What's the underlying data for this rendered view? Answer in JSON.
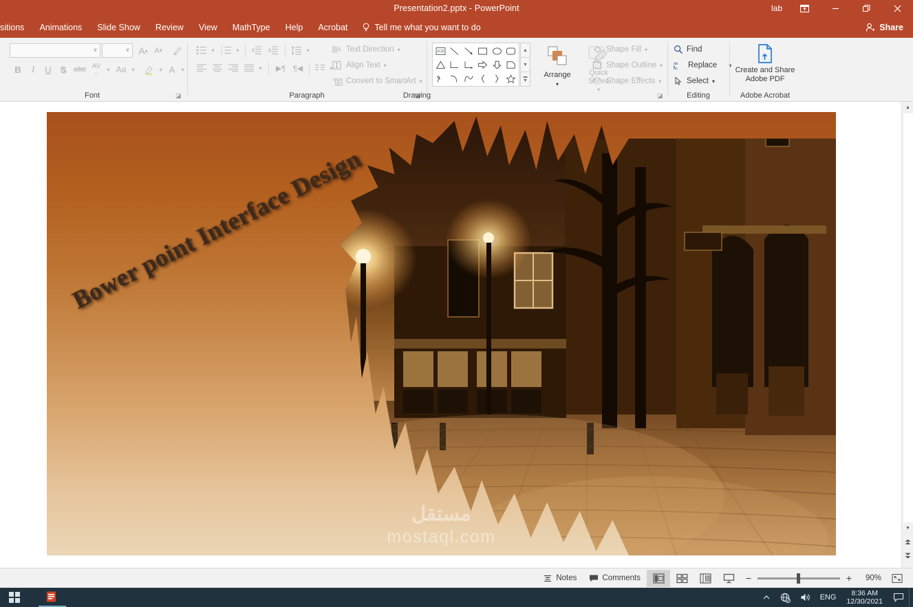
{
  "window": {
    "title": "Presentation2.pptx  -  PowerPoint",
    "user_label": "lab",
    "ribbon_display_options_icon": "ribbon-display-options-icon",
    "minimize_icon": "minimize-icon",
    "restore_icon": "restore-icon",
    "close_icon": "close-icon",
    "accent_color": "#b7472a"
  },
  "tabs": [
    {
      "label": "sitions"
    },
    {
      "label": "Animations"
    },
    {
      "label": "Slide Show"
    },
    {
      "label": "Review"
    },
    {
      "label": "View"
    },
    {
      "label": "MathType"
    },
    {
      "label": "Help"
    },
    {
      "label": "Acrobat"
    }
  ],
  "tellme": {
    "label": "Tell me what you want to do",
    "icon": "lightbulb-icon"
  },
  "share": {
    "label": "Share",
    "icon": "share-person-icon"
  },
  "ribbon": {
    "font_group": {
      "label": "Font",
      "font_name_value": "",
      "font_size_value": "",
      "grow_font": "A",
      "shrink_font": "A",
      "clear_formatting": "clear-formatting-icon",
      "bold": "B",
      "italic": "I",
      "underline": "U",
      "shadow": "S",
      "strikethrough": "abc",
      "character_spacing": "AV",
      "change_case": "Aa",
      "text_highlight": "text-highlight-icon",
      "font_color": "A"
    },
    "paragraph_group": {
      "label": "Paragraph",
      "bullets": "bullets-icon",
      "numbering": "numbering-icon",
      "decrease_indent": "decrease-indent-icon",
      "increase_indent": "increase-indent-icon",
      "line_spacing": "line-spacing-icon",
      "align_left": "align-left-icon",
      "align_center": "align-center-icon",
      "align_right": "align-right-icon",
      "justify": "justify-icon",
      "text_direction_rtl": "rtl-icon",
      "text_direction_ltr": "ltr-icon",
      "columns": "columns-icon",
      "text_direction_label": "Text Direction",
      "align_text_label": "Align Text",
      "convert_smartart_label": "Convert to SmartArt"
    },
    "drawing_group": {
      "label": "Drawing",
      "shapes": [
        "text-box-icon",
        "line-icon",
        "line-arrow-icon",
        "rectangle-icon",
        "oval-icon",
        "rounded-rectangle-icon",
        "triangle-icon",
        "elbow-connector-icon",
        "elbow-arrow-connector-icon",
        "right-arrow-icon",
        "down-arrow-icon",
        "flowchart-shape-icon",
        "scribble-icon",
        "curve-icon",
        "arc-icon",
        "left-brace-icon",
        "right-brace-icon",
        "star-icon"
      ],
      "gallery_up": "scroll-up-icon",
      "gallery_down": "scroll-down-icon",
      "gallery_more": "more-shapes-icon",
      "arrange_label": "Arrange",
      "quick_styles_label": "Quick Styles",
      "shape_fill_label": "Shape Fill",
      "shape_outline_label": "Shape Outline",
      "shape_effects_label": "Shape Effects"
    },
    "editing_group": {
      "label": "Editing",
      "find_label": "Find",
      "replace_label": "Replace",
      "select_label": "Select"
    },
    "acrobat_group": {
      "label": "Adobe Acrobat",
      "create_share_line1": "Create and Share",
      "create_share_line2": "Adobe PDF",
      "icon": "pdf-upload-icon"
    }
  },
  "slide": {
    "wordart_text": "Bower point Interface Design",
    "background_top_color": "#a8511c",
    "background_bottom_color": "#ead6b5",
    "photo_alt": "night street scene with pub and street lamps, shattered edge"
  },
  "watermark": {
    "arabic": "مستقل",
    "latin": "mostaql.com"
  },
  "scrollbar": {
    "up_arrow": "scroll-up-icon",
    "down_arrow": "scroll-down-icon",
    "previous_slide": "previous-slide-icon",
    "next_slide": "next-slide-icon"
  },
  "statusbar": {
    "notes_label": "Notes",
    "notes_icon": "notes-icon",
    "comments_label": "Comments",
    "comments_icon": "comments-icon",
    "views": [
      {
        "name": "normal-view",
        "icon": "normal-view-icon",
        "active": true
      },
      {
        "name": "slide-sorter-view",
        "icon": "slide-sorter-icon",
        "active": false
      },
      {
        "name": "reading-view",
        "icon": "reading-view-icon",
        "active": false
      },
      {
        "name": "slide-show-view",
        "icon": "slide-show-icon",
        "active": false
      }
    ],
    "zoom_out": "−",
    "zoom_in": "+",
    "zoom_level": "90%",
    "fit_slide_icon": "fit-slide-to-window-icon"
  },
  "taskbar": {
    "start_icon": "start-icon",
    "app_icon": "powerpoint-taskbar-icon",
    "tray": {
      "show_hidden_icon": "chevron-up-icon",
      "network_icon": "network-disconnected-icon",
      "volume_icon": "volume-icon",
      "language": "ENG",
      "time": "8:36 AM",
      "date": "12/30/2021",
      "action_center_icon": "notification-icon"
    }
  }
}
